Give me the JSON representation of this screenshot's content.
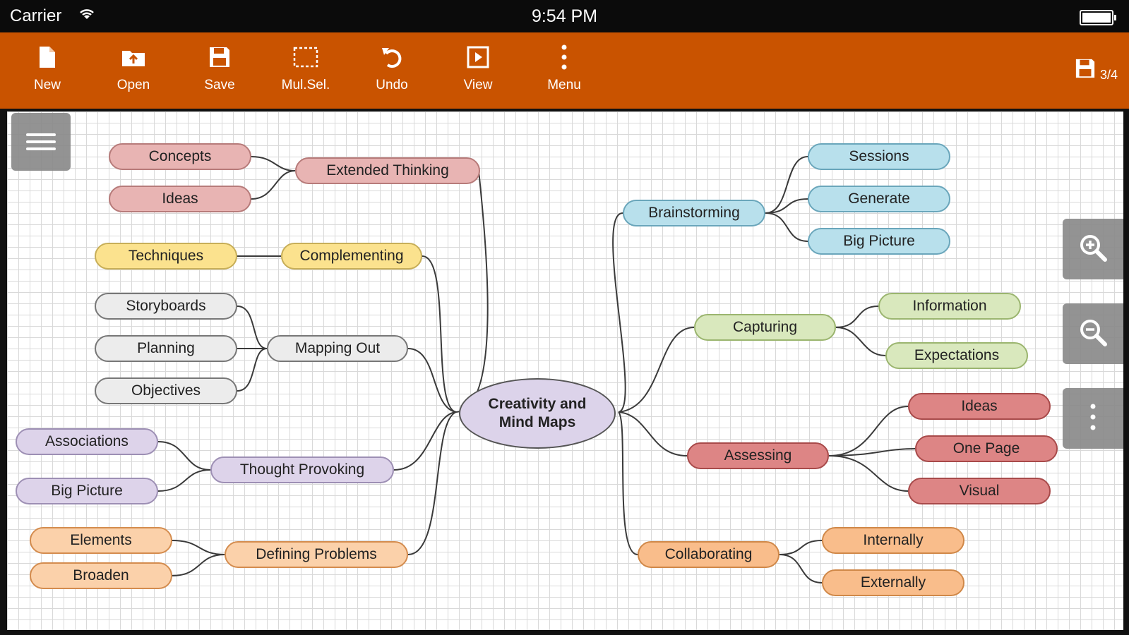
{
  "status_bar": {
    "carrier": "Carrier",
    "time": "9:54 PM"
  },
  "toolbar": {
    "buttons": [
      {
        "label": "New",
        "icon": "document-icon"
      },
      {
        "label": "Open",
        "icon": "folder-open-icon"
      },
      {
        "label": "Save",
        "icon": "save-icon"
      },
      {
        "label": "Mul.Sel.",
        "icon": "multi-select-icon"
      },
      {
        "label": "Undo",
        "icon": "undo-icon"
      },
      {
        "label": "View",
        "icon": "view-icon"
      },
      {
        "label": "Menu",
        "icon": "more-vertical-icon"
      }
    ],
    "page_indicator": "3/4"
  },
  "mindmap": {
    "center": {
      "line1": "Creativity and",
      "line2": "Mind Maps"
    },
    "left_branches": [
      {
        "label": "Extended Thinking",
        "color": "#e8b4b3",
        "children": [
          "Concepts",
          "Ideas"
        ]
      },
      {
        "label": "Complementing",
        "color": "#fbe28e",
        "children": [
          "Techniques"
        ]
      },
      {
        "label": "Mapping Out",
        "color": "#ececec",
        "children": [
          "Storyboards",
          "Planning",
          "Objectives"
        ]
      },
      {
        "label": "Thought Provoking",
        "color": "#ddd3ea",
        "children": [
          "Associations",
          "Big Picture"
        ]
      },
      {
        "label": "Defining Problems",
        "color": "#fbd1aa",
        "children": [
          "Elements",
          "Broaden"
        ]
      }
    ],
    "right_branches": [
      {
        "label": "Brainstorming",
        "color": "#b8e0ec",
        "children": [
          "Sessions",
          "Generate",
          "Big Picture"
        ]
      },
      {
        "label": "Capturing",
        "color": "#d9e8bd",
        "children": [
          "Information",
          "Expectations"
        ]
      },
      {
        "label": "Assessing",
        "color": "#dd8585",
        "children": [
          "Ideas",
          "One Page",
          "Visual"
        ]
      },
      {
        "label": "Collaborating",
        "color": "#f9bd8b",
        "children": [
          "Internally",
          "Externally"
        ]
      }
    ]
  },
  "side_controls": {
    "icons": [
      "zoom-in-icon",
      "zoom-out-icon",
      "more-vertical-icon"
    ]
  }
}
